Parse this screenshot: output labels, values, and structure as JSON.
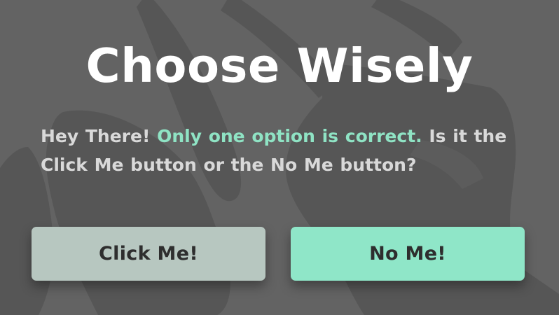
{
  "dialog": {
    "title": "Choose Wisely",
    "message": {
      "intro": "Hey There!",
      "highlight": "Only one option is correct.",
      "rest": "Is it the Click Me button or the No Me button?"
    }
  },
  "buttons": {
    "click_me": "Click Me!",
    "no_me": "No Me!"
  },
  "colors": {
    "background": "#636363",
    "title": "#ffffff",
    "message": "#d9d9d9",
    "highlight": "#8fe3c4",
    "click_me_bg": "#b7c7c0",
    "no_me_bg": "#8fe6c8",
    "button_text": "#2e2e2e"
  },
  "background_art": "hand-pointer-illustration"
}
